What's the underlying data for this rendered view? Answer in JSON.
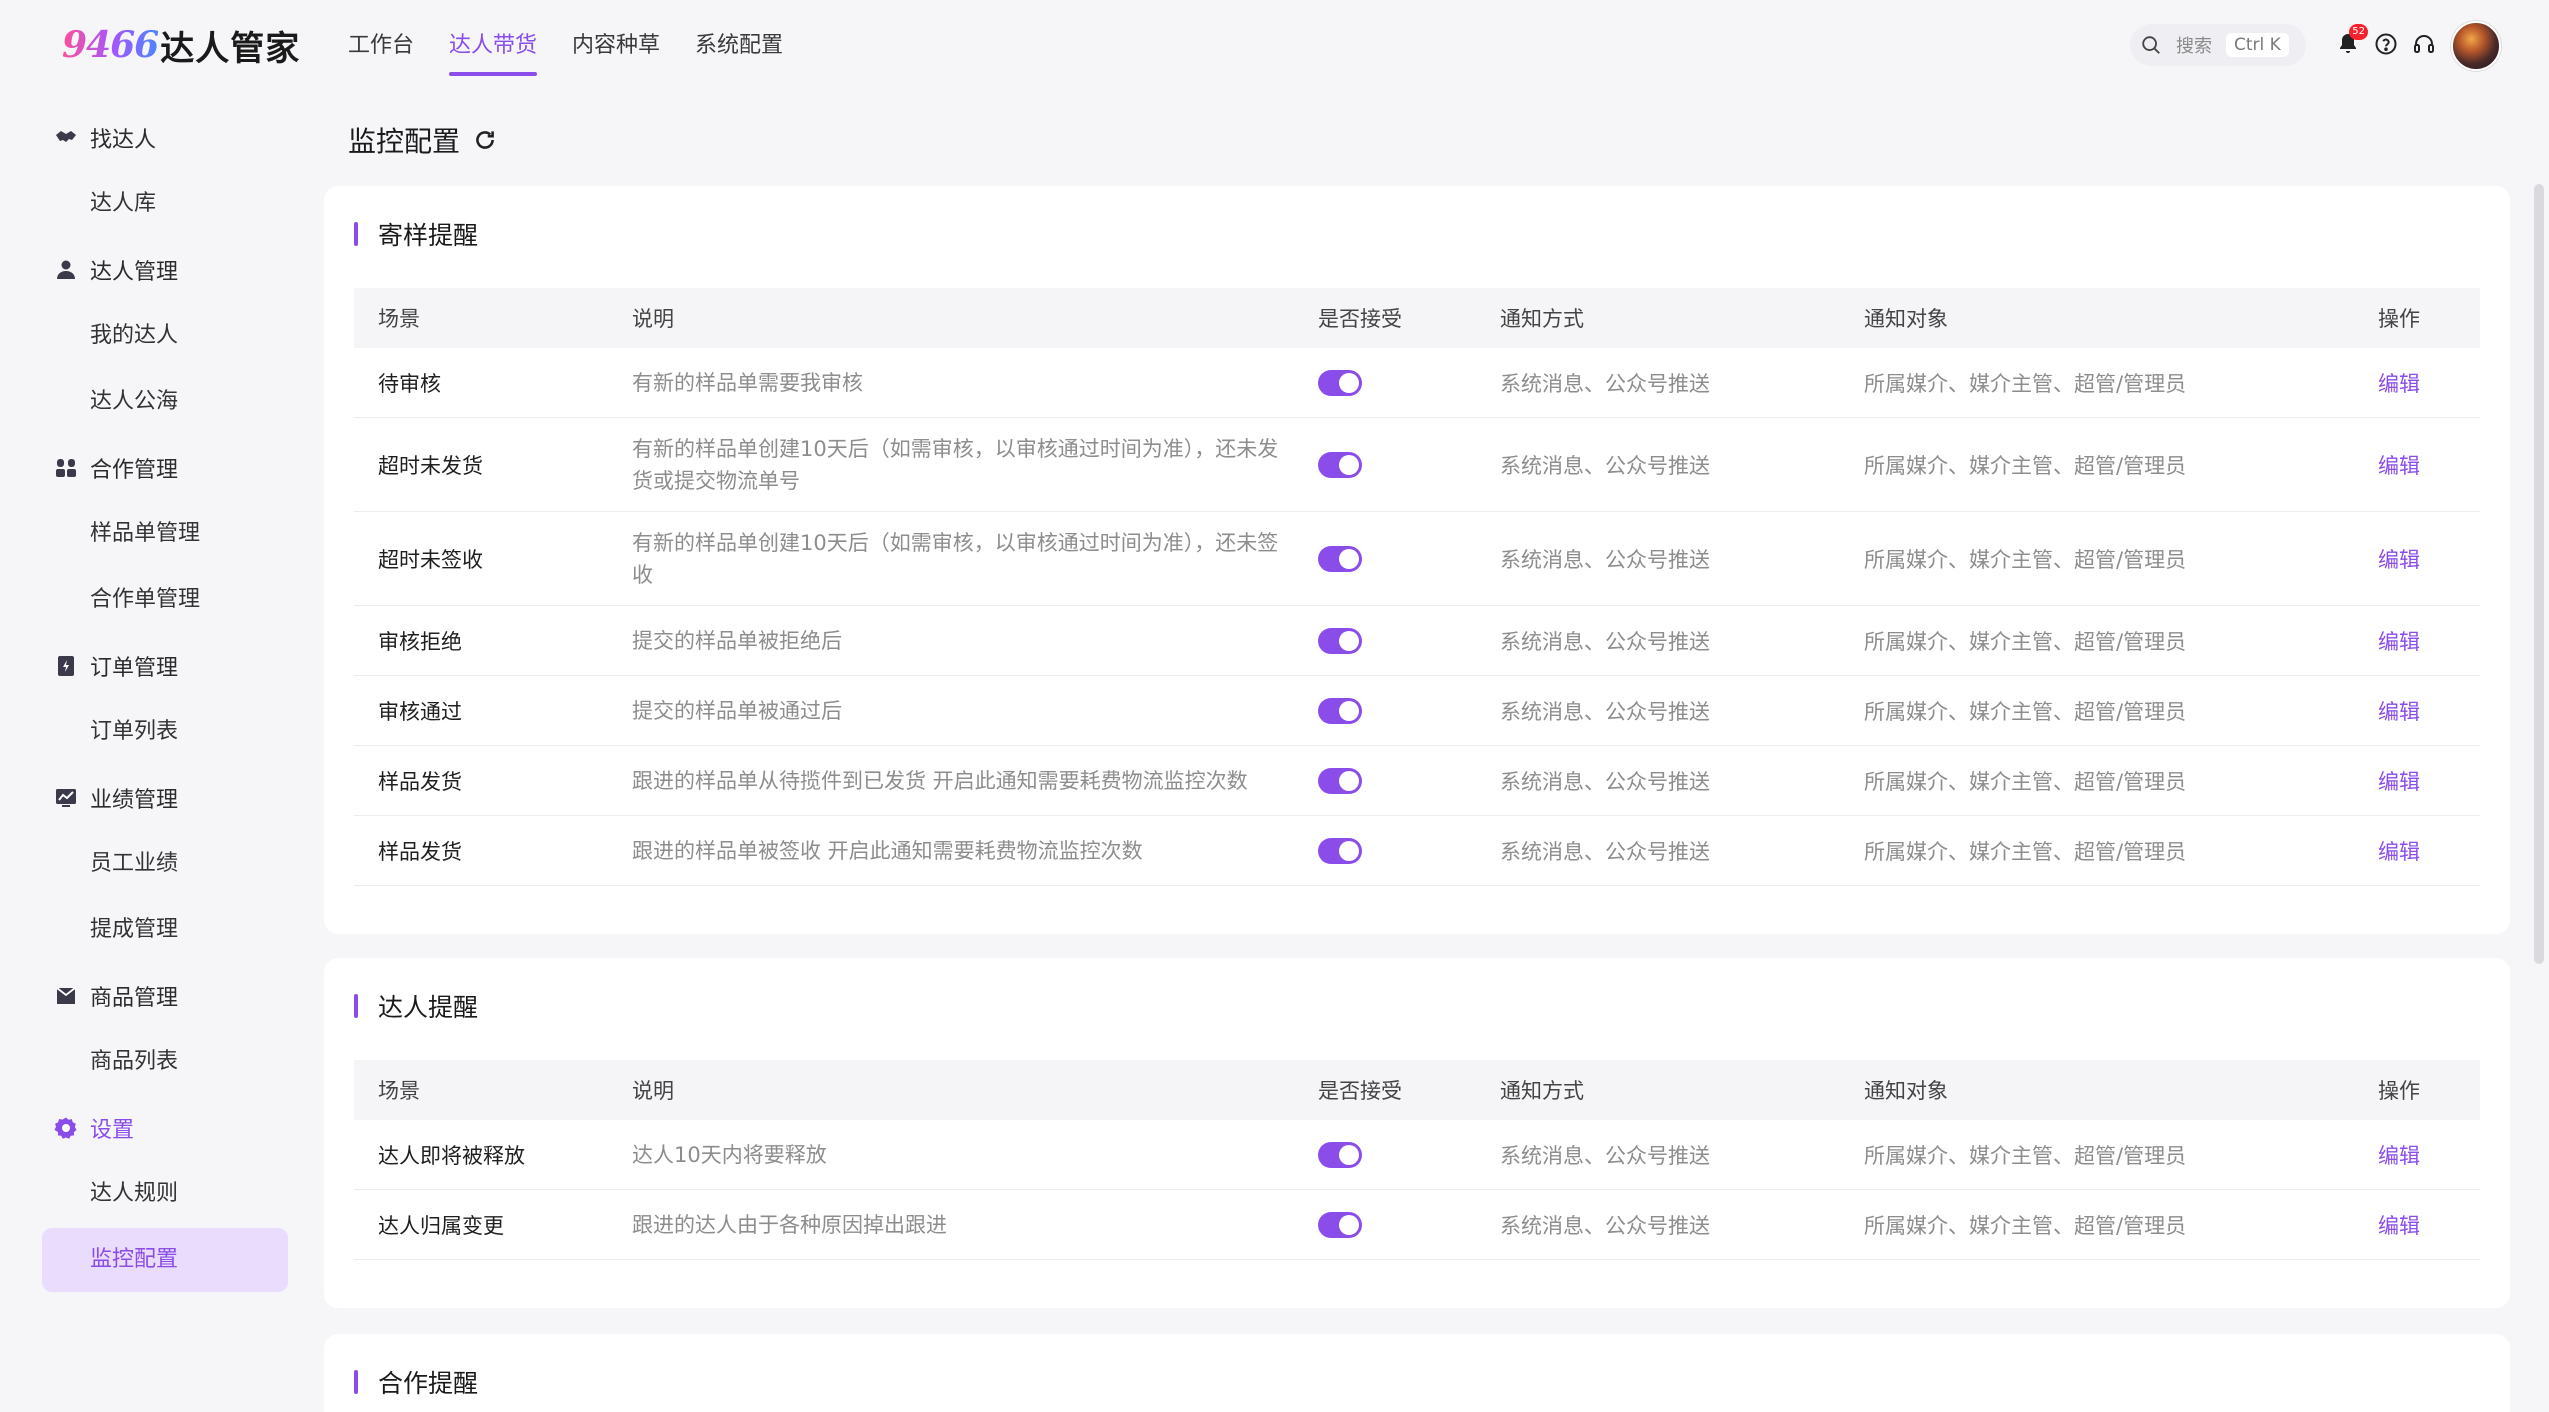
{
  "app": {
    "logo_num": "9466",
    "logo_text": "达人管家"
  },
  "nav": [
    "工作台",
    "达人带货",
    "内容种草",
    "系统配置"
  ],
  "nav_active": 1,
  "search": {
    "label": "搜索",
    "shortcut": "Ctrl K"
  },
  "notifications": {
    "count": "52"
  },
  "sidebar": {
    "groups": [
      {
        "label": "找达人",
        "icon": "handshake-icon",
        "items": [
          "达人库"
        ]
      },
      {
        "label": "达人管理",
        "icon": "user-icon",
        "items": [
          "我的达人",
          "达人公海"
        ]
      },
      {
        "label": "合作管理",
        "icon": "team-icon",
        "items": [
          "样品单管理",
          "合作单管理"
        ]
      },
      {
        "label": "订单管理",
        "icon": "order-icon",
        "items": [
          "订单列表"
        ]
      },
      {
        "label": "业绩管理",
        "icon": "chart-icon",
        "items": [
          "员工业绩",
          "提成管理"
        ]
      },
      {
        "label": "商品管理",
        "icon": "box-icon",
        "items": [
          "商品列表"
        ]
      },
      {
        "label": "设置",
        "icon": "gear-icon",
        "items": [
          "达人规则",
          "监控配置"
        ]
      }
    ],
    "active_item": "监控配置"
  },
  "page": {
    "title": "监控配置"
  },
  "columns": {
    "scene": "场景",
    "desc": "说明",
    "accept": "是否接受",
    "method": "通知方式",
    "target": "通知对象",
    "op": "操作"
  },
  "sections": [
    {
      "title": "寄样提醒",
      "rows": [
        {
          "scene": "待审核",
          "desc": "有新的样品单需要我审核",
          "accept": true,
          "method": "系统消息、公众号推送",
          "target": "所属媒介、媒介主管、超管/管理员",
          "op": "编辑"
        },
        {
          "scene": "超时未发货",
          "desc": "有新的样品单创建10天后（如需审核，以审核通过时间为准），还未发货或提交物流单号",
          "accept": true,
          "method": "系统消息、公众号推送",
          "target": "所属媒介、媒介主管、超管/管理员",
          "op": "编辑"
        },
        {
          "scene": "超时未签收",
          "desc": "有新的样品单创建10天后（如需审核，以审核通过时间为准），还未签收",
          "accept": true,
          "method": "系统消息、公众号推送",
          "target": "所属媒介、媒介主管、超管/管理员",
          "op": "编辑"
        },
        {
          "scene": "审核拒绝",
          "desc": "提交的样品单被拒绝后",
          "accept": true,
          "method": "系统消息、公众号推送",
          "target": "所属媒介、媒介主管、超管/管理员",
          "op": "编辑"
        },
        {
          "scene": "审核通过",
          "desc": "提交的样品单被通过后",
          "accept": true,
          "method": "系统消息、公众号推送",
          "target": "所属媒介、媒介主管、超管/管理员",
          "op": "编辑"
        },
        {
          "scene": "样品发货",
          "desc": "跟进的样品单从待揽件到已发货 开启此通知需要耗费物流监控次数",
          "accept": true,
          "method": "系统消息、公众号推送",
          "target": "所属媒介、媒介主管、超管/管理员",
          "op": "编辑"
        },
        {
          "scene": "样品发货",
          "desc": "跟进的样品单被签收 开启此通知需要耗费物流监控次数",
          "accept": true,
          "method": "系统消息、公众号推送",
          "target": "所属媒介、媒介主管、超管/管理员",
          "op": "编辑"
        }
      ]
    },
    {
      "title": "达人提醒",
      "rows": [
        {
          "scene": "达人即将被释放",
          "desc": "达人10天内将要释放",
          "accept": true,
          "method": "系统消息、公众号推送",
          "target": "所属媒介、媒介主管、超管/管理员",
          "op": "编辑"
        },
        {
          "scene": "达人归属变更",
          "desc": "跟进的达人由于各种原因掉出跟进",
          "accept": true,
          "method": "系统消息、公众号推送",
          "target": "所属媒介、媒介主管、超管/管理员",
          "op": "编辑"
        }
      ]
    },
    {
      "title": "合作提醒",
      "rows": []
    }
  ],
  "colors": {
    "accent": "#8b4dea",
    "active_bg": "#e9dcfd"
  }
}
